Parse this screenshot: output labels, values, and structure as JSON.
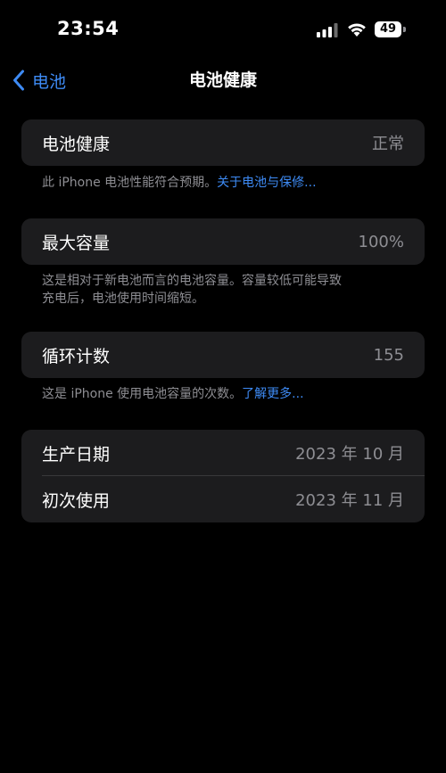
{
  "status_bar": {
    "time": "23:54",
    "battery_level": "49",
    "icons": [
      "signal-icon",
      "wifi-icon",
      "battery-icon"
    ]
  },
  "nav": {
    "back_label": "电池",
    "title": "电池健康"
  },
  "battery_health": {
    "label": "电池健康",
    "value": "正常",
    "footer_text": "此 iPhone 电池性能符合预期。",
    "footer_link": "关于电池与保修..."
  },
  "max_capacity": {
    "label": "最大容量",
    "value": "100%",
    "footer_line1": "这是相对于新电池而言的电池容量。容量较低可能导致",
    "footer_line2": "充电后，电池使用时间缩短。"
  },
  "cycle_count": {
    "label": "循环计数",
    "value": "155",
    "footer_text": "这是 iPhone 使用电池容量的次数。",
    "footer_link": "了解更多..."
  },
  "dates": {
    "manufacture_label": "生产日期",
    "manufacture_value": "2023 年 10 月",
    "first_use_label": "初次使用",
    "first_use_value": "2023 年 11 月"
  },
  "colors": {
    "background": "#000000",
    "cell": "#1c1c1e",
    "accent": "#3e8bf5",
    "secondary_text": "#8e8e93"
  }
}
